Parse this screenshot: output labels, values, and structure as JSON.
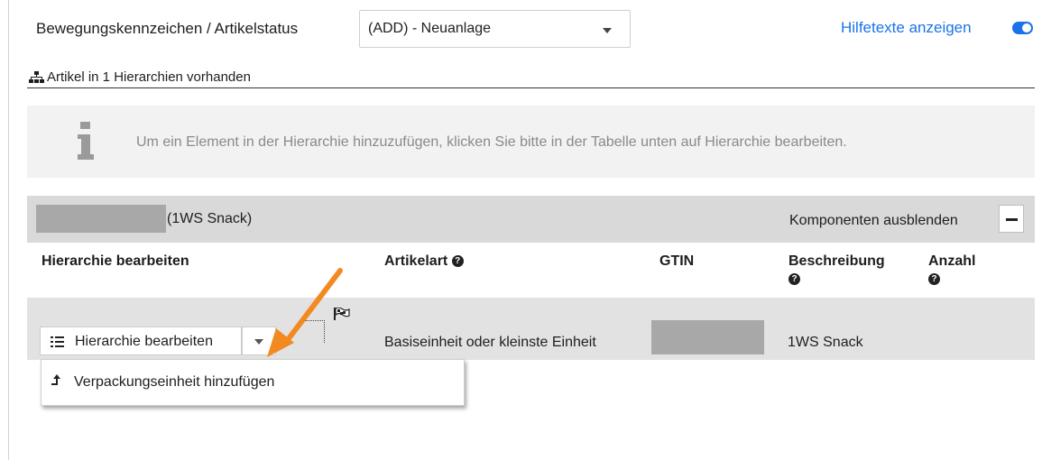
{
  "header": {
    "status_label": "Bewegungskennzeichen / Artikelstatus",
    "status_value": "(ADD) - Neuanlage",
    "help_link": "Hilfetexte anzeigen",
    "help_toggle_on": true
  },
  "hierarchy": {
    "heading": "Artikel in 1 Hierarchien vorhanden",
    "icon": "sitemap-icon"
  },
  "info": {
    "icon": "info-icon",
    "text": "Um ein Element in der Hierarchie hinzuzufügen, klicken Sie bitte in der Tabelle unten auf Hierarchie bearbeiten."
  },
  "group": {
    "name": "(1WS Snack)",
    "hide_components": "Komponenten ausblenden"
  },
  "table": {
    "headers": {
      "edit": "Hierarchie bearbeiten",
      "type": "Artikelart",
      "gtin": "GTIN",
      "description": "Beschreibung",
      "count": "Anzahl"
    },
    "rows": [
      {
        "edit_button": "Hierarchie bearbeiten",
        "type": "Basiseinheit oder kleinste Einheit",
        "description": "1WS Snack"
      }
    ]
  },
  "dropdown": {
    "items": [
      {
        "label": "Verpackungseinheit hinzufügen",
        "icon": "arrow-up-icon"
      }
    ]
  },
  "colors": {
    "accent": "#1a73e8",
    "annotation_arrow": "#f28a21",
    "info_bg": "#f2f2f2",
    "group_bg": "#d9d9d9",
    "row_bg": "#e2e2e2"
  }
}
